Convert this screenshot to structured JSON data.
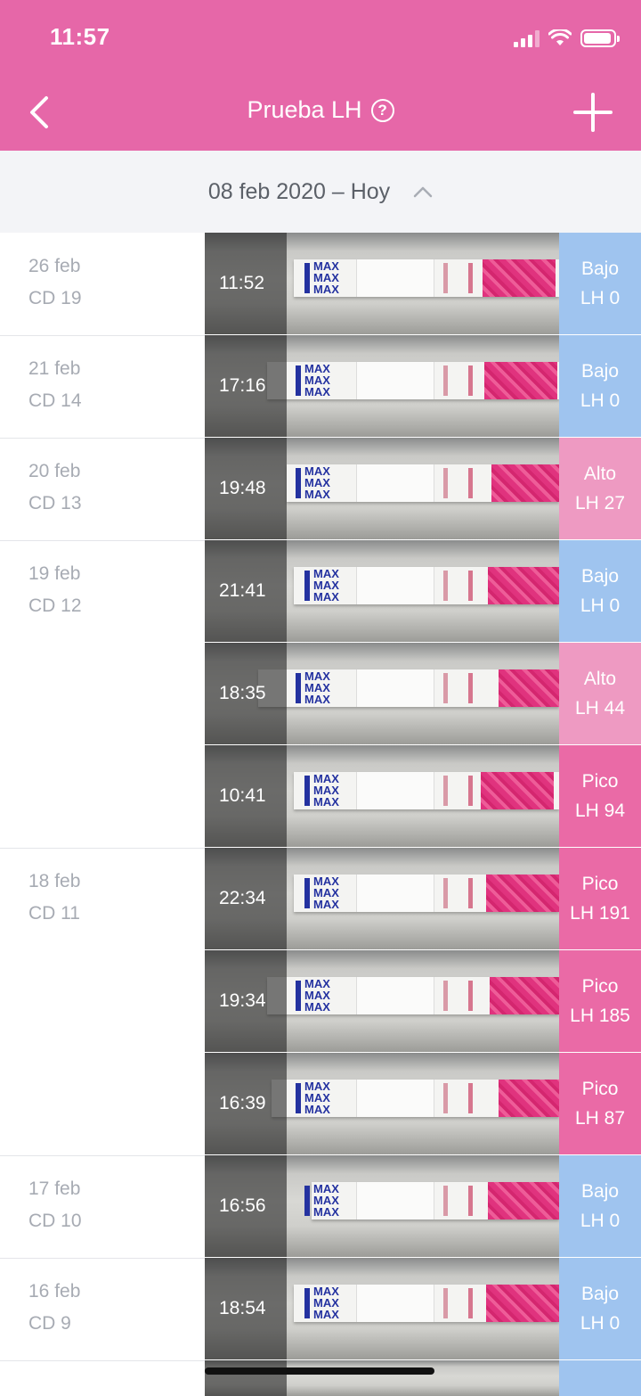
{
  "status": {
    "time": "11:57"
  },
  "nav": {
    "title": "Prueba LH",
    "help": "?"
  },
  "range": {
    "label": "08 feb 2020 – Hoy"
  },
  "colors": {
    "header": "#e667a8",
    "low": "#9fc4ef",
    "high": "#ee9ac2",
    "peak": "#ea6aa6"
  },
  "days": [
    {
      "date": "26 feb",
      "cd": "CD 19"
    },
    {
      "date": "21 feb",
      "cd": "CD 14"
    },
    {
      "date": "20 feb",
      "cd": "CD 13"
    },
    {
      "date": "19 feb",
      "cd": "CD 12"
    },
    {
      "date": "18 feb",
      "cd": "CD 11"
    },
    {
      "date": "17 feb",
      "cd": "CD 10"
    },
    {
      "date": "16 feb",
      "cd": "CD 9"
    }
  ],
  "tests": [
    {
      "time": "11:52",
      "level": "Bajo",
      "lh": "LH 0"
    },
    {
      "time": "17:16",
      "level": "Bajo",
      "lh": "LH 0"
    },
    {
      "time": "19:48",
      "level": "Alto",
      "lh": "LH 27"
    },
    {
      "time": "21:41",
      "level": "Bajo",
      "lh": "LH 0"
    },
    {
      "time": "18:35",
      "level": "Alto",
      "lh": "LH 44"
    },
    {
      "time": "10:41",
      "level": "Pico",
      "lh": "LH 94"
    },
    {
      "time": "22:34",
      "level": "Pico",
      "lh": "LH 191"
    },
    {
      "time": "19:34",
      "level": "Pico",
      "lh": "LH 185"
    },
    {
      "time": "16:39",
      "level": "Pico",
      "lh": "LH 87"
    },
    {
      "time": "16:56",
      "level": "Bajo",
      "lh": "LH 0"
    },
    {
      "time": "18:54",
      "level": "Bajo",
      "lh": "LH 0"
    }
  ]
}
